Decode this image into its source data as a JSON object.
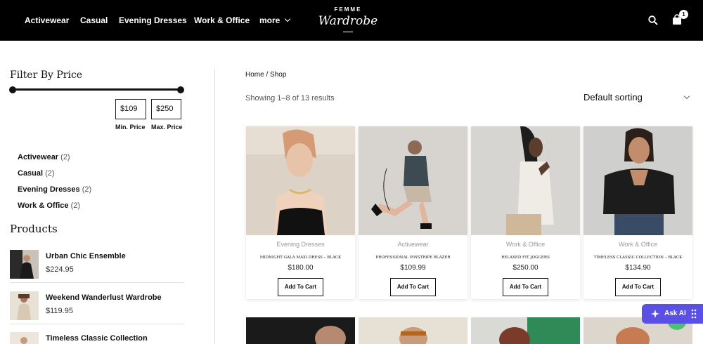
{
  "header": {
    "nav": [
      "Activewear",
      "Casual",
      "Evening Dresses",
      "Work & Office"
    ],
    "more_label": "more",
    "brand_small": "FEMME",
    "brand_main": "Wardrobe",
    "cart_count": "1",
    "icons": [
      "search-icon",
      "shopping-bag-icon",
      "chevron-down-icon"
    ]
  },
  "sidebar": {
    "filter_title": "Filter By Price",
    "min_value": "$109",
    "max_value": "$250",
    "min_label": "Min. Price",
    "max_label": "Max. Price",
    "categories": [
      {
        "name": "Activewear",
        "count": "(2)"
      },
      {
        "name": "Casual",
        "count": "(2)"
      },
      {
        "name": "Evening Dresses",
        "count": "(2)"
      },
      {
        "name": "Work & Office",
        "count": "(2)"
      }
    ],
    "products_title": "Products",
    "products": [
      {
        "name": "Urban Chic Ensemble",
        "price": "$224.95"
      },
      {
        "name": "Weekend Wanderlust Wardrobe",
        "price": "$119.95"
      },
      {
        "name": "Timeless Classic Collection",
        "price": ""
      }
    ]
  },
  "shop": {
    "breadcrumb_home": "Home",
    "breadcrumb_sep": " / ",
    "breadcrumb_current": "Shop",
    "result_count": "Showing 1–8 of 13 results",
    "sort_label": "Default sorting",
    "add_to_cart": "Add To Cart",
    "products": [
      {
        "category": "Evening Dresses",
        "title": "MIDNIGHT GALA MAXI DRESS – BLACK",
        "price": "$180.00"
      },
      {
        "category": "Activewear",
        "title": "PROFESSIONAL PINSTRIPE BLAZER",
        "price": "$109.99"
      },
      {
        "category": "Work & Office",
        "title": "RELAXED FIT JOGGERS",
        "price": "$250.00"
      },
      {
        "category": "Work & Office",
        "title": "TIMELESS CLASSIC COLLECTION – BLACK",
        "price": "$134.90"
      }
    ]
  },
  "widget": {
    "ask_ai": "Ask AI"
  },
  "colors": {
    "header_bg": "#000000",
    "accent": "#5b50e6",
    "whatsapp": "#2fbf5a"
  }
}
